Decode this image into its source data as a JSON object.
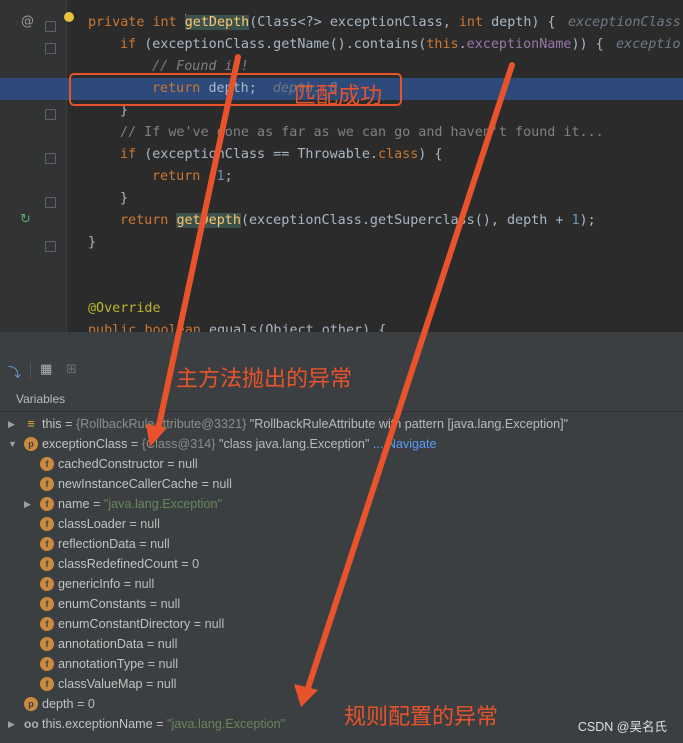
{
  "editor": {
    "lines": [
      {
        "id": "l1",
        "parts": [
          [
            "private ",
            "kw"
          ],
          [
            "int ",
            "kw"
          ],
          [
            "|",
            ""
          ],
          [
            "getDepth",
            "fn-usage"
          ],
          [
            "(Class<?> exceptionClass, ",
            ""
          ],
          [
            "int ",
            "kw"
          ],
          [
            "depth) {",
            ""
          ]
        ],
        "hint": "exceptionClass"
      },
      {
        "id": "l2",
        "parts": [
          [
            "if ",
            "kw"
          ],
          [
            "(exceptionClass.getName().contains(",
            ""
          ],
          [
            "this",
            "kw"
          ],
          [
            ".",
            ""
          ],
          [
            "exceptionName",
            "fld"
          ],
          [
            ")) {",
            ""
          ]
        ],
        "hint": "exceptio"
      },
      {
        "id": "l3",
        "parts": [
          [
            "// Found it!",
            "cmt"
          ]
        ]
      },
      {
        "id": "l4",
        "parts": [
          [
            "return ",
            "kw"
          ],
          [
            "depth;",
            ""
          ]
        ],
        "inline": "depth: 0"
      },
      {
        "id": "l5",
        "parts": [
          [
            "}",
            ""
          ]
        ]
      },
      {
        "id": "l6",
        "parts": [
          [
            "// If we've gone as far as we can go and haven't found it...",
            "cmt2"
          ]
        ]
      },
      {
        "id": "l7",
        "parts": [
          [
            "if ",
            "kw"
          ],
          [
            "(exceptionClass == Throwable.",
            ""
          ],
          [
            "class",
            "kw"
          ],
          [
            ") {",
            ""
          ]
        ]
      },
      {
        "id": "l8",
        "parts": [
          [
            "return ",
            "kw"
          ],
          [
            "-1",
            "num"
          ],
          [
            ";",
            ""
          ]
        ]
      },
      {
        "id": "l9",
        "parts": [
          [
            "}",
            ""
          ]
        ]
      },
      {
        "id": "l10",
        "parts": [
          [
            "return ",
            "kw"
          ],
          [
            "getDepth",
            "fn-usage"
          ],
          [
            "(exceptionClass.getSuperclass(), depth + ",
            ""
          ],
          [
            "1",
            "num"
          ],
          [
            ");",
            ""
          ]
        ]
      },
      {
        "id": "l11",
        "parts": [
          [
            "}",
            ""
          ]
        ]
      },
      {
        "id": "l12",
        "parts": []
      },
      {
        "id": "l13",
        "parts": [
          [
            "@Override",
            "ann"
          ]
        ]
      },
      {
        "id": "l14",
        "parts": [
          [
            "public ",
            "kw"
          ],
          [
            "boolean ",
            "kw"
          ],
          [
            "equals(Object other) {",
            ""
          ]
        ]
      }
    ]
  },
  "debugger": {
    "variables_label": "Variables",
    "rows": [
      {
        "indent": 0,
        "tri": "▶",
        "icon": "≡",
        "iconcls": "ic-eq",
        "name": "this",
        "eq": " = ",
        "meta": "{RollbackRuleAttribute@3321} ",
        "value": "\"RollbackRuleAttribute with pattern [java.lang.Exception]\"",
        "valcls": ""
      },
      {
        "indent": 0,
        "tri": "▼",
        "icon": "p",
        "iconcls": "ic-p",
        "name": "exceptionClass",
        "eq": " = ",
        "meta": "{Class@314} ",
        "value": "\"class java.lang.Exception\"",
        "valcls": "",
        "nav": " ... Navigate"
      },
      {
        "indent": 1,
        "tri": "",
        "icon": "f",
        "iconcls": "ic-f",
        "name": "cachedConstructor",
        "eq": " = ",
        "meta": "",
        "value": "null",
        "valcls": ""
      },
      {
        "indent": 1,
        "tri": "",
        "icon": "f",
        "iconcls": "ic-f",
        "name": "newInstanceCallerCache",
        "eq": " = ",
        "meta": "",
        "value": "null",
        "valcls": ""
      },
      {
        "indent": 1,
        "tri": "▶",
        "icon": "f",
        "iconcls": "ic-f",
        "name": "name",
        "eq": " = ",
        "meta": "",
        "value": "\"java.lang.Exception\"",
        "valcls": "vstr"
      },
      {
        "indent": 1,
        "tri": "",
        "icon": "f",
        "iconcls": "ic-f",
        "name": "classLoader",
        "eq": " = ",
        "meta": "",
        "value": "null",
        "valcls": ""
      },
      {
        "indent": 1,
        "tri": "",
        "icon": "f",
        "iconcls": "ic-f",
        "name": "reflectionData",
        "eq": " = ",
        "meta": "",
        "value": "null",
        "valcls": ""
      },
      {
        "indent": 1,
        "tri": "",
        "icon": "f",
        "iconcls": "ic-f",
        "name": "classRedefinedCount",
        "eq": " = ",
        "meta": "",
        "value": "0",
        "valcls": ""
      },
      {
        "indent": 1,
        "tri": "",
        "icon": "f",
        "iconcls": "ic-f",
        "name": "genericInfo",
        "eq": " = ",
        "meta": "",
        "value": "null",
        "valcls": ""
      },
      {
        "indent": 1,
        "tri": "",
        "icon": "f",
        "iconcls": "ic-f",
        "name": "enumConstants",
        "eq": " = ",
        "meta": "",
        "value": "null",
        "valcls": ""
      },
      {
        "indent": 1,
        "tri": "",
        "icon": "f",
        "iconcls": "ic-f",
        "name": "enumConstantDirectory",
        "eq": " = ",
        "meta": "",
        "value": "null",
        "valcls": ""
      },
      {
        "indent": 1,
        "tri": "",
        "icon": "f",
        "iconcls": "ic-f",
        "name": "annotationData",
        "eq": " = ",
        "meta": "",
        "value": "null",
        "valcls": ""
      },
      {
        "indent": 1,
        "tri": "",
        "icon": "f",
        "iconcls": "ic-f",
        "name": "annotationType",
        "eq": " = ",
        "meta": "",
        "value": "null",
        "valcls": ""
      },
      {
        "indent": 1,
        "tri": "",
        "icon": "f",
        "iconcls": "ic-f",
        "name": "classValueMap",
        "eq": " = ",
        "meta": "",
        "value": "null",
        "valcls": ""
      },
      {
        "indent": 0,
        "tri": "",
        "icon": "p",
        "iconcls": "ic-p",
        "name": "depth",
        "eq": " = ",
        "meta": "",
        "value": "0",
        "valcls": ""
      },
      {
        "indent": 0,
        "tri": "▶",
        "icon": "oo",
        "iconcls": "ic-oo",
        "name": "this.exceptionName",
        "eq": " = ",
        "meta": "",
        "value": "\"java.lang.Exception\"",
        "valcls": "vstr"
      }
    ]
  },
  "annotations": {
    "match_success": "匹配成功",
    "main_exception": "主方法抛出的异常",
    "rule_exception": "规则配置的异常",
    "accent_color": "#e8532c"
  },
  "watermark": "CSDN @吴名氏",
  "icons": [
    "at-sign-icon",
    "lightbulb-icon",
    "breakpoint-icon",
    "fold-icon",
    "step-icon",
    "table-icon",
    "settings-icon"
  ]
}
